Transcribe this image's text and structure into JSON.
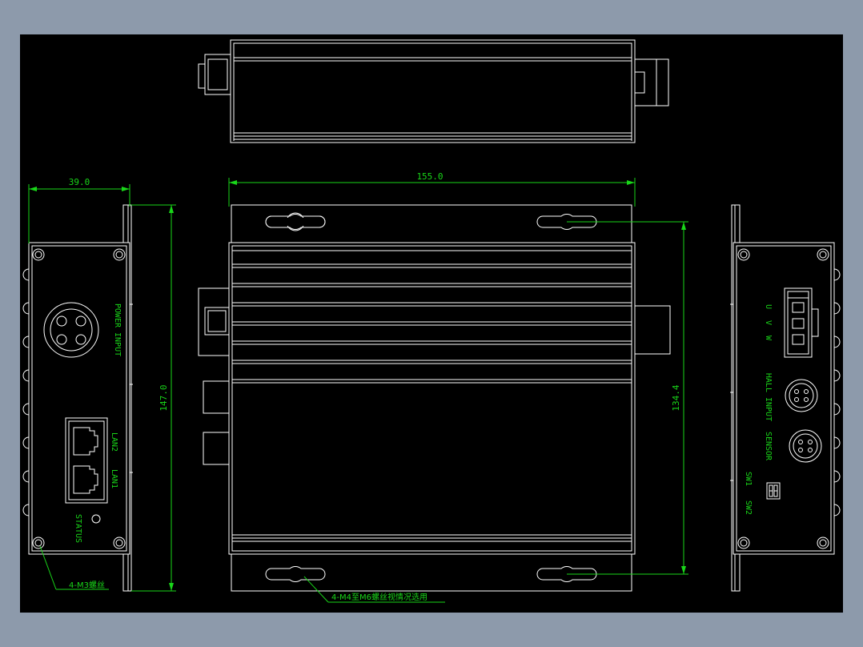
{
  "dimensions": {
    "width_left": "39.0",
    "height_left": "147.0",
    "width_front": "155.0",
    "height_right": "134.4"
  },
  "notes": {
    "m3_screws": "4-M3螺丝",
    "mount_screws": "4-M4至M6螺丝视情况选用"
  },
  "left_panel": {
    "power_input": "POWER INPUT",
    "lan2": "LAN2",
    "lan1": "LAN1",
    "status": "STATUS"
  },
  "right_panel": {
    "u": "U",
    "v": "V",
    "w": "W",
    "hall_input": "HALL INPUT",
    "sensor": "SENSOR",
    "sw1": "SW1",
    "sw2": "SW2"
  },
  "colors": {
    "background": "#8d9aab",
    "canvas": "#000000",
    "outline": "#ffffff",
    "dimension": "#19d619"
  }
}
